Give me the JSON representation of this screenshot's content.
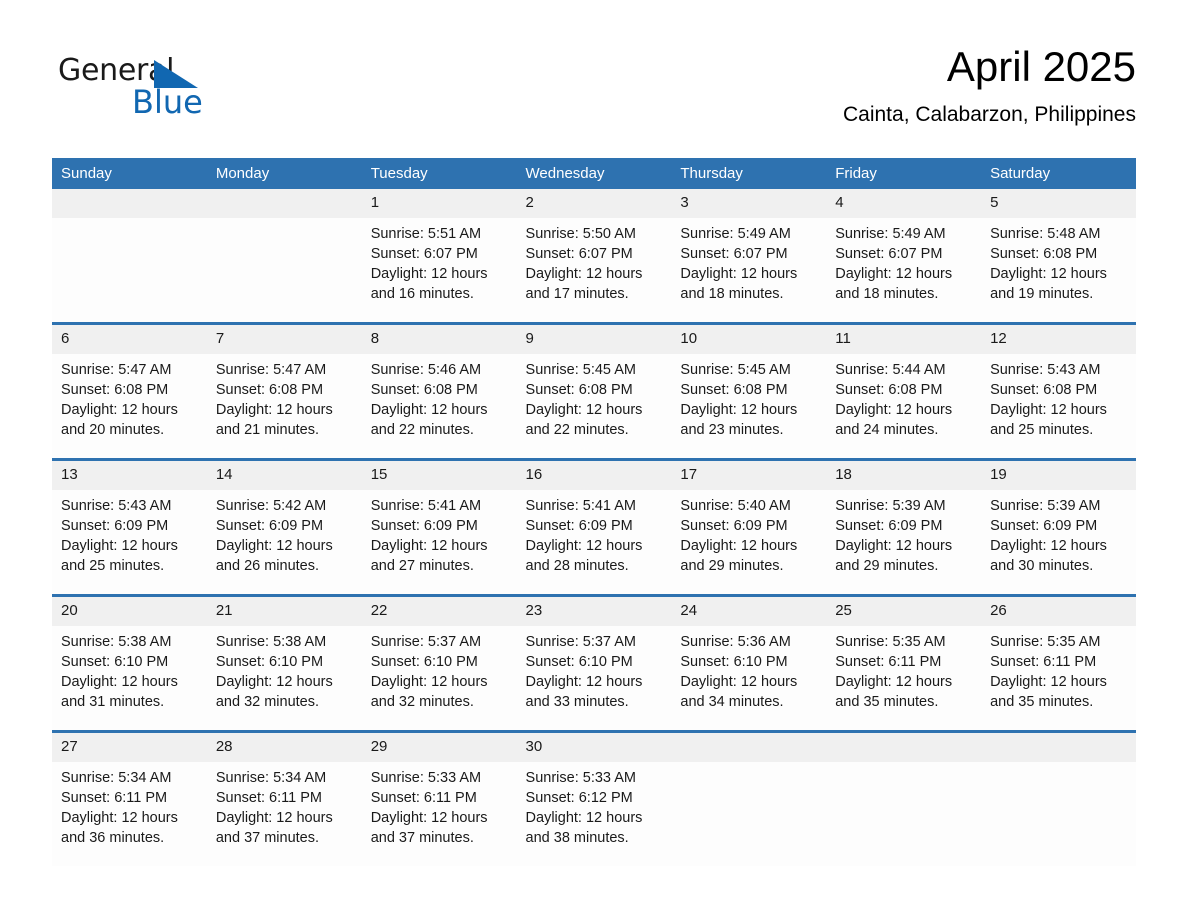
{
  "brand": {
    "word_one": "General",
    "word_two": "Blue",
    "triangle_color": "#1167b1",
    "blue_color": "#1167b1"
  },
  "header": {
    "month_title": "April 2025",
    "location": "Cainta, Calabarzon, Philippines"
  },
  "theme": {
    "header_blue": "#2e72b0",
    "date_band_gray": "#f0f0f0",
    "cell_white": "#fdfdfd"
  },
  "calendar": {
    "weekday_headers": [
      "Sunday",
      "Monday",
      "Tuesday",
      "Wednesday",
      "Thursday",
      "Friday",
      "Saturday"
    ],
    "weeks": [
      [
        {
          "date": "",
          "sunrise": "",
          "sunset": "",
          "daylight_line1": "",
          "daylight_line2": ""
        },
        {
          "date": "",
          "sunrise": "",
          "sunset": "",
          "daylight_line1": "",
          "daylight_line2": ""
        },
        {
          "date": "1",
          "sunrise": "Sunrise: 5:51 AM",
          "sunset": "Sunset: 6:07 PM",
          "daylight_line1": "Daylight: 12 hours",
          "daylight_line2": "and 16 minutes."
        },
        {
          "date": "2",
          "sunrise": "Sunrise: 5:50 AM",
          "sunset": "Sunset: 6:07 PM",
          "daylight_line1": "Daylight: 12 hours",
          "daylight_line2": "and 17 minutes."
        },
        {
          "date": "3",
          "sunrise": "Sunrise: 5:49 AM",
          "sunset": "Sunset: 6:07 PM",
          "daylight_line1": "Daylight: 12 hours",
          "daylight_line2": "and 18 minutes."
        },
        {
          "date": "4",
          "sunrise": "Sunrise: 5:49 AM",
          "sunset": "Sunset: 6:07 PM",
          "daylight_line1": "Daylight: 12 hours",
          "daylight_line2": "and 18 minutes."
        },
        {
          "date": "5",
          "sunrise": "Sunrise: 5:48 AM",
          "sunset": "Sunset: 6:08 PM",
          "daylight_line1": "Daylight: 12 hours",
          "daylight_line2": "and 19 minutes."
        }
      ],
      [
        {
          "date": "6",
          "sunrise": "Sunrise: 5:47 AM",
          "sunset": "Sunset: 6:08 PM",
          "daylight_line1": "Daylight: 12 hours",
          "daylight_line2": "and 20 minutes."
        },
        {
          "date": "7",
          "sunrise": "Sunrise: 5:47 AM",
          "sunset": "Sunset: 6:08 PM",
          "daylight_line1": "Daylight: 12 hours",
          "daylight_line2": "and 21 minutes."
        },
        {
          "date": "8",
          "sunrise": "Sunrise: 5:46 AM",
          "sunset": "Sunset: 6:08 PM",
          "daylight_line1": "Daylight: 12 hours",
          "daylight_line2": "and 22 minutes."
        },
        {
          "date": "9",
          "sunrise": "Sunrise: 5:45 AM",
          "sunset": "Sunset: 6:08 PM",
          "daylight_line1": "Daylight: 12 hours",
          "daylight_line2": "and 22 minutes."
        },
        {
          "date": "10",
          "sunrise": "Sunrise: 5:45 AM",
          "sunset": "Sunset: 6:08 PM",
          "daylight_line1": "Daylight: 12 hours",
          "daylight_line2": "and 23 minutes."
        },
        {
          "date": "11",
          "sunrise": "Sunrise: 5:44 AM",
          "sunset": "Sunset: 6:08 PM",
          "daylight_line1": "Daylight: 12 hours",
          "daylight_line2": "and 24 minutes."
        },
        {
          "date": "12",
          "sunrise": "Sunrise: 5:43 AM",
          "sunset": "Sunset: 6:08 PM",
          "daylight_line1": "Daylight: 12 hours",
          "daylight_line2": "and 25 minutes."
        }
      ],
      [
        {
          "date": "13",
          "sunrise": "Sunrise: 5:43 AM",
          "sunset": "Sunset: 6:09 PM",
          "daylight_line1": "Daylight: 12 hours",
          "daylight_line2": "and 25 minutes."
        },
        {
          "date": "14",
          "sunrise": "Sunrise: 5:42 AM",
          "sunset": "Sunset: 6:09 PM",
          "daylight_line1": "Daylight: 12 hours",
          "daylight_line2": "and 26 minutes."
        },
        {
          "date": "15",
          "sunrise": "Sunrise: 5:41 AM",
          "sunset": "Sunset: 6:09 PM",
          "daylight_line1": "Daylight: 12 hours",
          "daylight_line2": "and 27 minutes."
        },
        {
          "date": "16",
          "sunrise": "Sunrise: 5:41 AM",
          "sunset": "Sunset: 6:09 PM",
          "daylight_line1": "Daylight: 12 hours",
          "daylight_line2": "and 28 minutes."
        },
        {
          "date": "17",
          "sunrise": "Sunrise: 5:40 AM",
          "sunset": "Sunset: 6:09 PM",
          "daylight_line1": "Daylight: 12 hours",
          "daylight_line2": "and 29 minutes."
        },
        {
          "date": "18",
          "sunrise": "Sunrise: 5:39 AM",
          "sunset": "Sunset: 6:09 PM",
          "daylight_line1": "Daylight: 12 hours",
          "daylight_line2": "and 29 minutes."
        },
        {
          "date": "19",
          "sunrise": "Sunrise: 5:39 AM",
          "sunset": "Sunset: 6:09 PM",
          "daylight_line1": "Daylight: 12 hours",
          "daylight_line2": "and 30 minutes."
        }
      ],
      [
        {
          "date": "20",
          "sunrise": "Sunrise: 5:38 AM",
          "sunset": "Sunset: 6:10 PM",
          "daylight_line1": "Daylight: 12 hours",
          "daylight_line2": "and 31 minutes."
        },
        {
          "date": "21",
          "sunrise": "Sunrise: 5:38 AM",
          "sunset": "Sunset: 6:10 PM",
          "daylight_line1": "Daylight: 12 hours",
          "daylight_line2": "and 32 minutes."
        },
        {
          "date": "22",
          "sunrise": "Sunrise: 5:37 AM",
          "sunset": "Sunset: 6:10 PM",
          "daylight_line1": "Daylight: 12 hours",
          "daylight_line2": "and 32 minutes."
        },
        {
          "date": "23",
          "sunrise": "Sunrise: 5:37 AM",
          "sunset": "Sunset: 6:10 PM",
          "daylight_line1": "Daylight: 12 hours",
          "daylight_line2": "and 33 minutes."
        },
        {
          "date": "24",
          "sunrise": "Sunrise: 5:36 AM",
          "sunset": "Sunset: 6:10 PM",
          "daylight_line1": "Daylight: 12 hours",
          "daylight_line2": "and 34 minutes."
        },
        {
          "date": "25",
          "sunrise": "Sunrise: 5:35 AM",
          "sunset": "Sunset: 6:11 PM",
          "daylight_line1": "Daylight: 12 hours",
          "daylight_line2": "and 35 minutes."
        },
        {
          "date": "26",
          "sunrise": "Sunrise: 5:35 AM",
          "sunset": "Sunset: 6:11 PM",
          "daylight_line1": "Daylight: 12 hours",
          "daylight_line2": "and 35 minutes."
        }
      ],
      [
        {
          "date": "27",
          "sunrise": "Sunrise: 5:34 AM",
          "sunset": "Sunset: 6:11 PM",
          "daylight_line1": "Daylight: 12 hours",
          "daylight_line2": "and 36 minutes."
        },
        {
          "date": "28",
          "sunrise": "Sunrise: 5:34 AM",
          "sunset": "Sunset: 6:11 PM",
          "daylight_line1": "Daylight: 12 hours",
          "daylight_line2": "and 37 minutes."
        },
        {
          "date": "29",
          "sunrise": "Sunrise: 5:33 AM",
          "sunset": "Sunset: 6:11 PM",
          "daylight_line1": "Daylight: 12 hours",
          "daylight_line2": "and 37 minutes."
        },
        {
          "date": "30",
          "sunrise": "Sunrise: 5:33 AM",
          "sunset": "Sunset: 6:12 PM",
          "daylight_line1": "Daylight: 12 hours",
          "daylight_line2": "and 38 minutes."
        },
        {
          "date": "",
          "sunrise": "",
          "sunset": "",
          "daylight_line1": "",
          "daylight_line2": ""
        },
        {
          "date": "",
          "sunrise": "",
          "sunset": "",
          "daylight_line1": "",
          "daylight_line2": ""
        },
        {
          "date": "",
          "sunrise": "",
          "sunset": "",
          "daylight_line1": "",
          "daylight_line2": ""
        }
      ]
    ]
  }
}
